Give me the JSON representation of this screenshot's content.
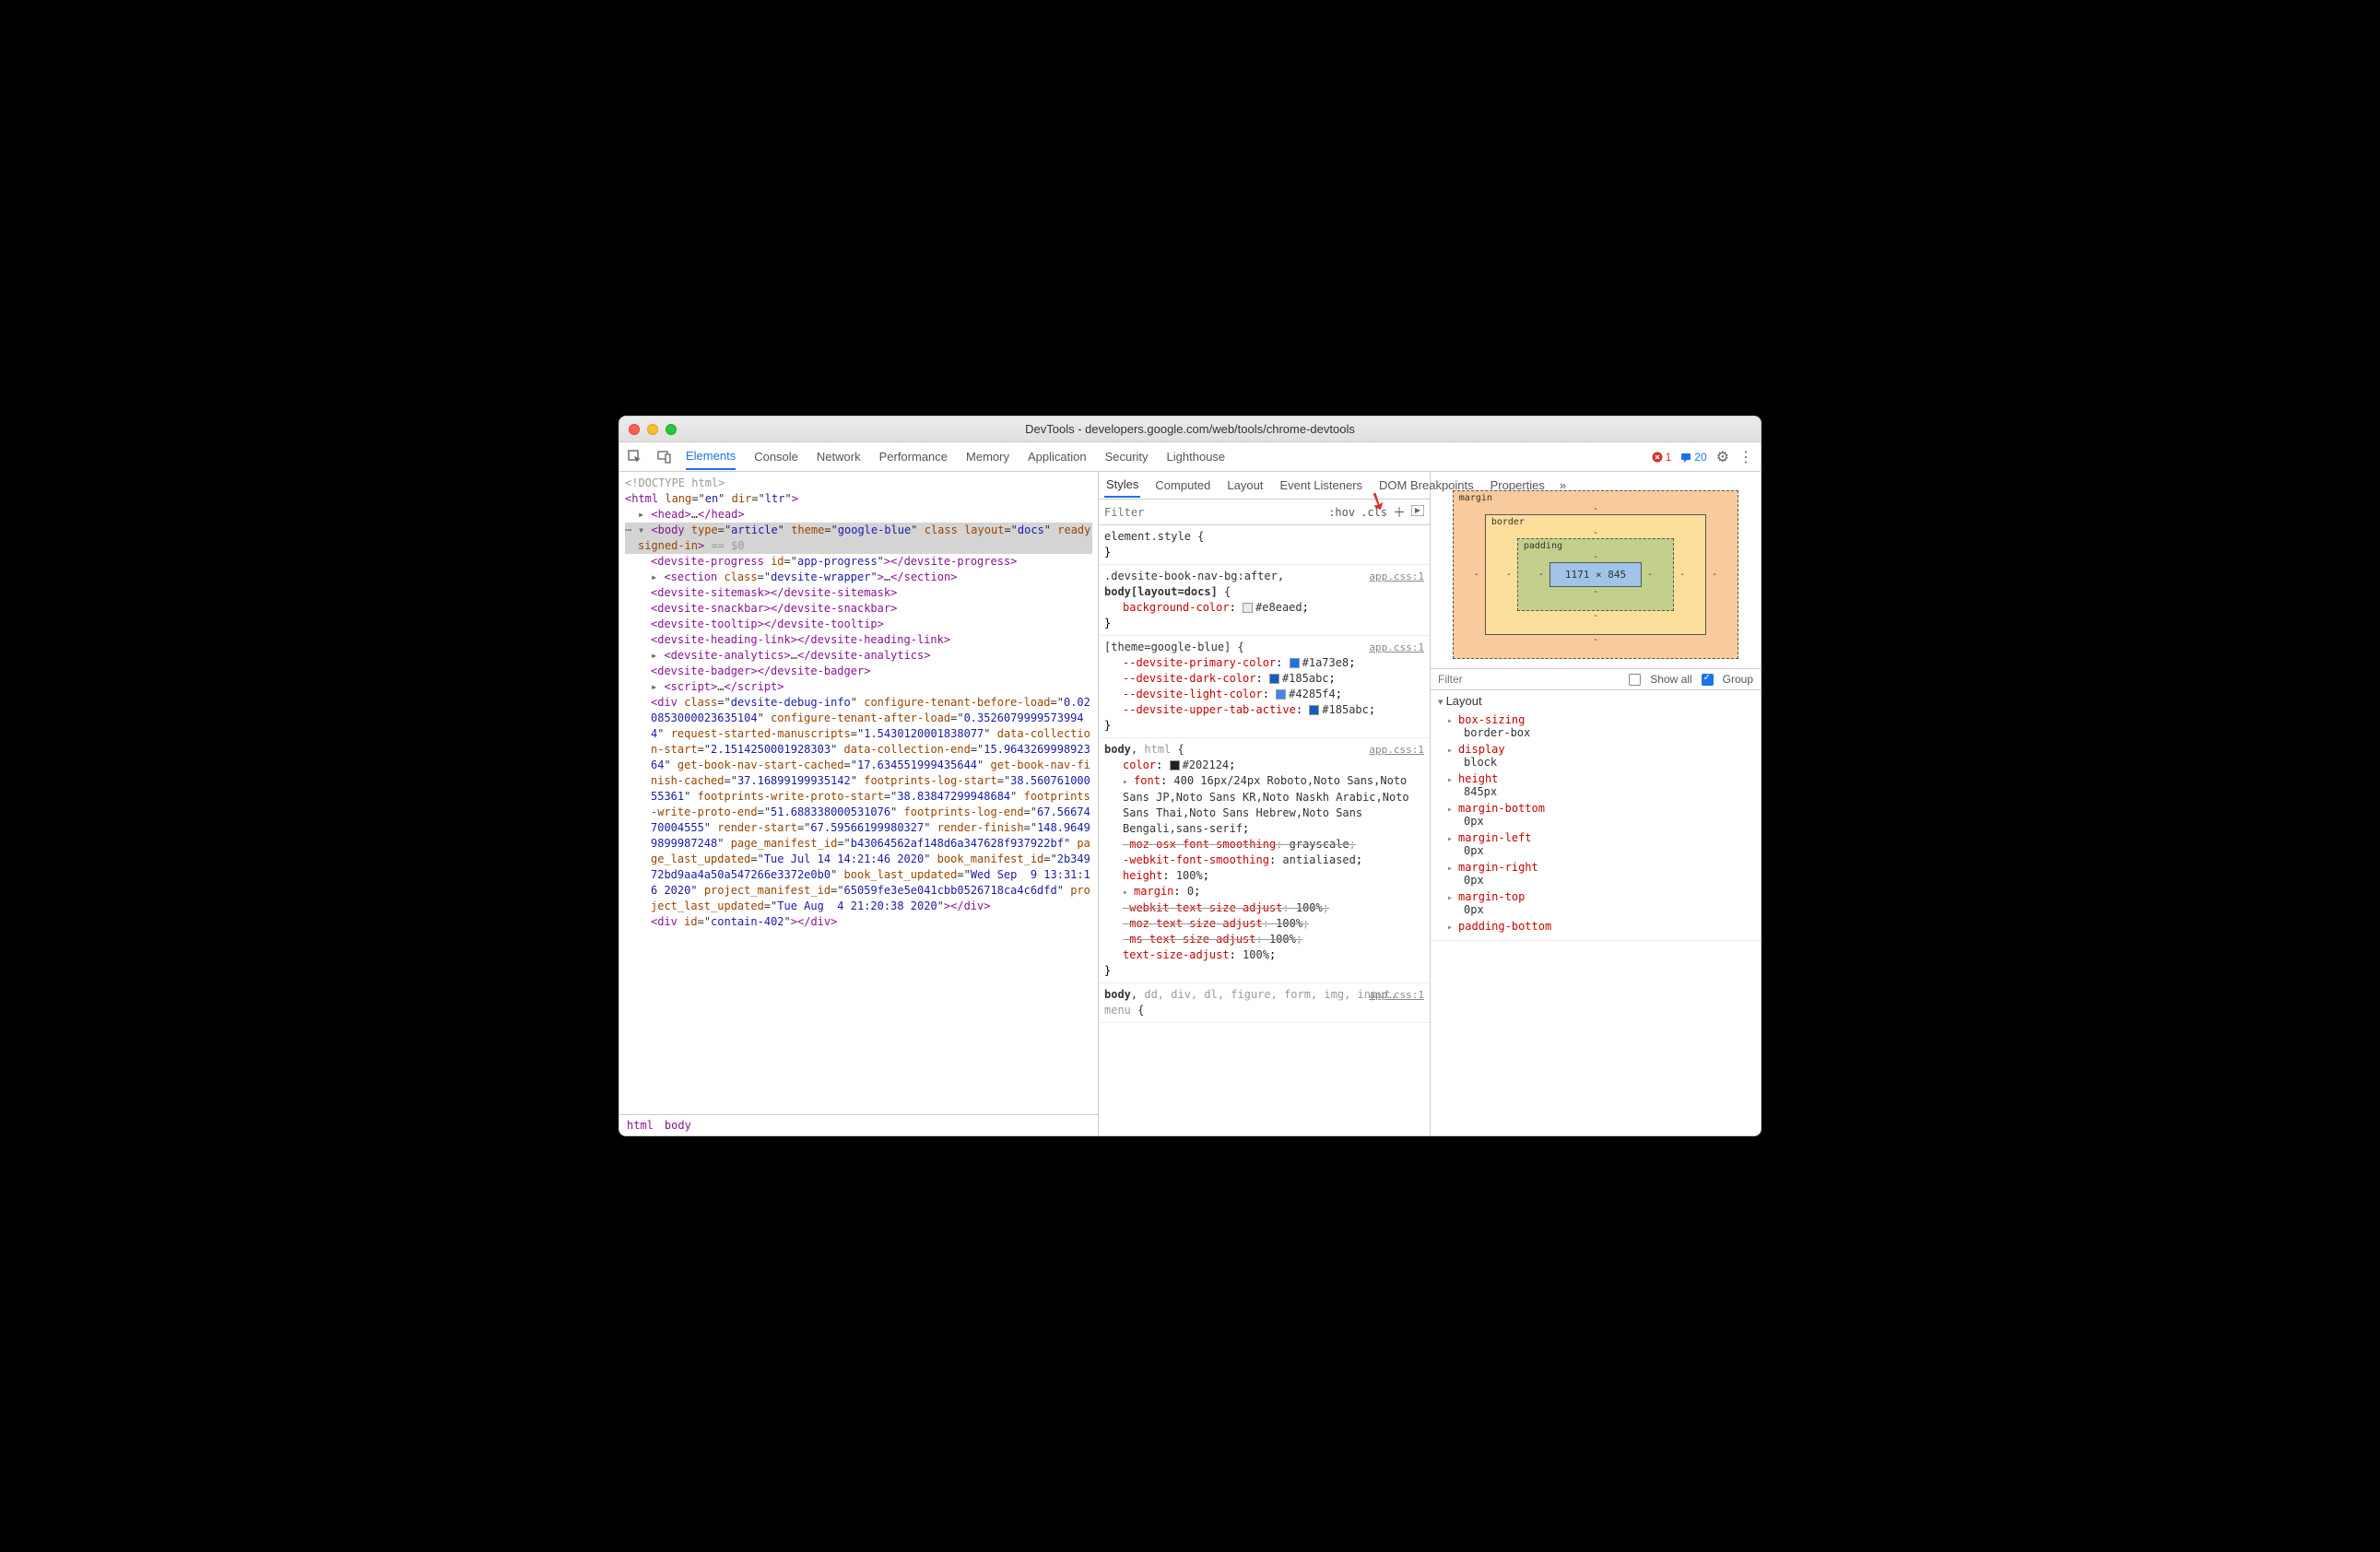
{
  "window": {
    "title": "DevTools - developers.google.com/web/tools/chrome-devtools"
  },
  "toolbar": {
    "tabs": [
      "Elements",
      "Console",
      "Network",
      "Performance",
      "Memory",
      "Application",
      "Security",
      "Lighthouse"
    ],
    "active_tab": "Elements",
    "error_count": "1",
    "message_count": "20"
  },
  "elements": {
    "breadcrumb": [
      "html",
      "body"
    ],
    "top_gray": "<!DOCTYPE html>",
    "dom_lines": [
      {
        "html": "<span class='tag'>&lt;html</span> <span class='attr'>lang</span>=\"<span class='val'>en</span>\" <span class='attr'>dir</span>=\"<span class='val'>ltr</span>\"<span class='tag'>&gt;</span>",
        "indent": 0
      },
      {
        "html": "<span class='caret'></span><span class='tag'>&lt;head&gt;</span>…<span class='tag'>&lt;/head&gt;</span>",
        "indent": 1
      }
    ],
    "selected_html": "<span class='caret-open'></span><span class='tag'>&lt;body</span> <span class='attr'>type</span>=\"<span class='val'>article</span>\" <span class='attr'>theme</span>=\"<span class='val'>google-blue</span>\" <span class='attr'>class</span> <span class='attr'>layout</span>=\"<span class='val'>docs</span>\" <span class='attr'>ready</span> <span class='attr'>signed-in</span><span class='tag'>&gt;</span> <span class='eqzero'>== $0</span>",
    "body_children": [
      "<span class='tag'>&lt;devsite-progress</span> <span class='attr'>id</span>=\"<span class='val'>app-progress</span>\"<span class='tag'>&gt;&lt;/devsite-progress&gt;</span>",
      "<span class='caret'></span><span class='tag'>&lt;section</span> <span class='attr'>class</span>=\"<span class='val'>devsite-wrapper</span>\"<span class='tag'>&gt;</span>…<span class='tag'>&lt;/section&gt;</span>",
      "<span class='tag'>&lt;devsite-sitemask&gt;&lt;/devsite-sitemask&gt;</span>",
      "<span class='tag'>&lt;devsite-snackbar&gt;&lt;/devsite-snackbar&gt;</span>",
      "<span class='tag'>&lt;devsite-tooltip&gt;&lt;/devsite-tooltip&gt;</span>",
      "<span class='tag'>&lt;devsite-heading-link&gt;&lt;/devsite-heading-link&gt;</span>",
      "<span class='caret'></span><span class='tag'>&lt;devsite-analytics&gt;</span>…<span class='tag'>&lt;/devsite-analytics&gt;</span>",
      "<span class='tag'>&lt;devsite-badger&gt;&lt;/devsite-badger&gt;</span>",
      "<span class='caret'></span><span class='tag'>&lt;script&gt;</span>…<span class='tag'>&lt;/script&gt;</span>",
      "<span class='tag'>&lt;div</span> <span class='attr'>class</span>=\"<span class='val'>devsite-debug-info</span>\" <span class='attr'>configure-tenant-before-load</span>=\"<span class='val'>0.020853000023635104</span>\" <span class='attr'>configure-tenant-after-load</span>=\"<span class='val'>0.35260799995739944</span>\" <span class='attr'>request-started-manuscripts</span>=\"<span class='val'>1.5430120001838077</span>\" <span class='attr'>data-collection-start</span>=\"<span class='val'>2.1514250001928303</span>\" <span class='attr'>data-collection-end</span>=\"<span class='val'>15.964326999892364</span>\" <span class='attr'>get-book-nav-start-cached</span>=\"<span class='val'>17.634551999435644</span>\" <span class='attr'>get-book-nav-finish-cached</span>=\"<span class='val'>37.16899199935142</span>\" <span class='attr'>footprints-log-start</span>=\"<span class='val'>38.56076100055361</span>\" <span class='attr'>footprints-write-proto-start</span>=\"<span class='val'>38.83847299948684</span>\" <span class='attr'>footprints-write-proto-end</span>=\"<span class='val'>51.688338000531076</span>\" <span class='attr'>footprints-log-end</span>=\"<span class='val'>67.5667470004555</span>\" <span class='attr'>render-start</span>=\"<span class='val'>67.59566199980327</span>\" <span class='attr'>render-finish</span>=\"<span class='val'>148.96499899987248</span>\" <span class='attr'>page_manifest_id</span>=\"<span class='val'>b43064562af148d6a347628f937922bf</span>\" <span class='attr'>page_last_updated</span>=\"<span class='val'>Tue Jul 14 14:21:46 2020</span>\" <span class='attr'>book_manifest_id</span>=\"<span class='val'>2b34972bd9aa4a50a547266e3372e0b0</span>\" <span class='attr'>book_last_updated</span>=\"<span class='val'>Wed Sep  9 13:31:16 2020</span>\" <span class='attr'>project_manifest_id</span>=\"<span class='val'>65059fe3e5e041cbb0526718ca4c6dfd</span>\" <span class='attr'>project_last_updated</span>=\"<span class='val'>Tue Aug  4 21:20:38 2020</span>\"<span class='tag'>&gt;&lt;/div&gt;</span>",
      "<span class='tag'>&lt;div</span> <span class='attr'>id</span>=\"<span class='val'>contain-402</span>\"<span class='tag'>&gt;&lt;/div&gt;</span>"
    ]
  },
  "styles": {
    "subtabs": [
      "Styles",
      "Computed",
      "Layout",
      "Event Listeners",
      "DOM Breakpoints",
      "Properties"
    ],
    "active_subtab": "Styles",
    "filter_placeholder": "Filter",
    "hov_label": ":hov",
    "cls_label": ".cls",
    "rules": [
      {
        "selector": "element.style {",
        "src": "",
        "props": [],
        "close": "}"
      },
      {
        "selector": ".devsite-book-nav-bg:after,<br><b>body[layout=docs]</b> {",
        "src": "app.css:1",
        "props": [
          {
            "n": "background-color",
            "v": "#e8eaed",
            "sw": "#e8eaed"
          }
        ],
        "close": "}"
      },
      {
        "selector": "[theme=google-blue] {",
        "src": "app.css:1",
        "props": [
          {
            "n": "--devsite-primary-color",
            "v": "#1a73e8",
            "sw": "#1a73e8"
          },
          {
            "n": "--devsite-dark-color",
            "v": "#185abc",
            "sw": "#185abc"
          },
          {
            "n": "--devsite-light-color",
            "v": "#4285f4",
            "sw": "#4285f4"
          },
          {
            "n": "--devsite-upper-tab-active",
            "v": "#185abc",
            "sw": "#185abc"
          }
        ],
        "close": "}"
      },
      {
        "selector": "<b>body</b>, <span class='dim'>html</span> {",
        "src": "app.css:1",
        "props": [
          {
            "n": "color",
            "v": "#202124",
            "sw": "#202124"
          },
          {
            "n": "font",
            "v": "400 16px/24px Roboto,Noto Sans,Noto Sans JP,Noto Sans KR,Noto Naskh Arabic,Noto Sans Thai,Noto Sans Hebrew,Noto Sans Bengali,sans-serif",
            "tri": true
          },
          {
            "n": "-moz-osx-font-smoothing",
            "v": "grayscale",
            "strike": true
          },
          {
            "n": "-webkit-font-smoothing",
            "v": "antialiased"
          },
          {
            "n": "height",
            "v": "100%"
          },
          {
            "n": "margin",
            "v": "0",
            "tri": true
          },
          {
            "n": "-webkit-text-size-adjust",
            "v": "100%",
            "strike": true
          },
          {
            "n": "-moz-text-size-adjust",
            "v": "100%",
            "strike": true
          },
          {
            "n": "-ms-text-size-adjust",
            "v": "100%",
            "strike": true
          },
          {
            "n": "text-size-adjust",
            "v": "100%"
          }
        ],
        "close": "}"
      },
      {
        "selector": "<b>body</b>, <span class='dim'>dd, div, dl, figure, form, img, input, menu</span> {",
        "src": "app.css:1",
        "props": [],
        "close": ""
      }
    ]
  },
  "computed": {
    "box": {
      "content": "1171 × 845"
    },
    "filter_placeholder": "Filter",
    "showall_label": "Show all",
    "group_label": "Group",
    "layout_header": "Layout",
    "props": [
      {
        "n": "box-sizing",
        "v": "border-box"
      },
      {
        "n": "display",
        "v": "block"
      },
      {
        "n": "height",
        "v": "845px"
      },
      {
        "n": "margin-bottom",
        "v": "0px"
      },
      {
        "n": "margin-left",
        "v": "0px"
      },
      {
        "n": "margin-right",
        "v": "0px"
      },
      {
        "n": "margin-top",
        "v": "0px"
      },
      {
        "n": "padding-bottom",
        "v": ""
      }
    ]
  }
}
